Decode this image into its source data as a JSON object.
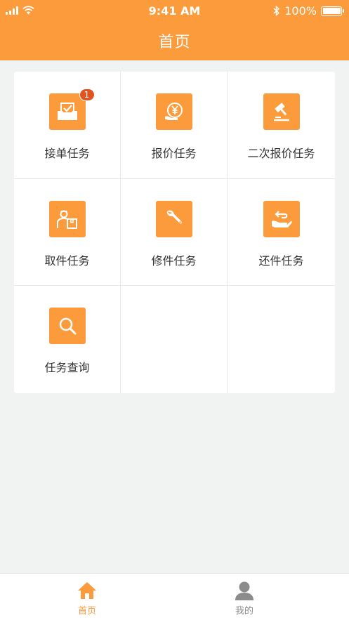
{
  "status_bar": {
    "time": "9:41 AM",
    "battery_text": "100%"
  },
  "header": {
    "title": "首页"
  },
  "tiles": [
    {
      "label": "接单任务",
      "icon": "inbox-check-icon",
      "badge": "1"
    },
    {
      "label": "报价任务",
      "icon": "yuan-quote-icon"
    },
    {
      "label": "二次报价任务",
      "icon": "gavel-icon"
    },
    {
      "label": "取件任务",
      "icon": "courier-package-icon"
    },
    {
      "label": "修件任务",
      "icon": "wrench-icon"
    },
    {
      "label": "还件任务",
      "icon": "hand-return-icon"
    },
    {
      "label": "任务查询",
      "icon": "search-icon"
    }
  ],
  "tabbar": {
    "home": {
      "label": "首页",
      "icon": "home-icon",
      "active": true
    },
    "mine": {
      "label": "我的",
      "icon": "user-icon",
      "active": false
    }
  },
  "colors": {
    "accent": "#fb9b3c",
    "badge": "#e2541f",
    "inactive_tab": "#8c8c8c",
    "background": "#f1f2f2"
  }
}
